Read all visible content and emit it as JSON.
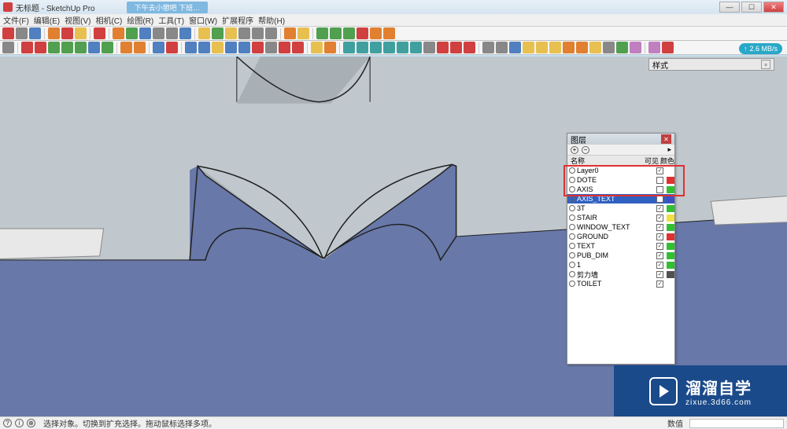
{
  "titlebar": {
    "title": "无标题 - SketchUp Pro",
    "tab": "下午去小憩吧  下班…"
  },
  "menubar": [
    "文件(F)",
    "编辑(E)",
    "视图(V)",
    "相机(C)",
    "绘图(R)",
    "工具(T)",
    "窗口(W)",
    "扩展程序",
    "帮助(H)"
  ],
  "speed": "2.6 MB/s",
  "style_panel": {
    "title": "样式"
  },
  "layers_panel": {
    "title": "图层",
    "header": {
      "name": "名称",
      "visible": "可见",
      "color": "颜色"
    },
    "rows": [
      {
        "name": "Layer0",
        "checked": true,
        "color": "#ffffff",
        "selected": false
      },
      {
        "name": "DOTE",
        "checked": false,
        "color": "#e03030",
        "selected": false
      },
      {
        "name": "AXIS",
        "checked": false,
        "color": "#30c030",
        "selected": false
      },
      {
        "name": "AXIS_TEXT",
        "checked": false,
        "color": "#4050c0",
        "selected": true
      },
      {
        "name": "3T",
        "checked": true,
        "color": "#30c030",
        "selected": false
      },
      {
        "name": "STAIR",
        "checked": true,
        "color": "#f0e040",
        "selected": false
      },
      {
        "name": "WINDOW_TEXT",
        "checked": true,
        "color": "#30c030",
        "selected": false
      },
      {
        "name": "GROUND",
        "checked": true,
        "color": "#e03030",
        "selected": false
      },
      {
        "name": "TEXT",
        "checked": true,
        "color": "#30c030",
        "selected": false
      },
      {
        "name": "PUB_DIM",
        "checked": true,
        "color": "#30c030",
        "selected": false
      },
      {
        "name": "1",
        "checked": true,
        "color": "#30c030",
        "selected": false
      },
      {
        "name": "剪力墙",
        "checked": true,
        "color": "#505050",
        "selected": false
      },
      {
        "name": "TOILET",
        "checked": true,
        "color": "#ffffff",
        "selected": false
      }
    ]
  },
  "statusbar": {
    "hint": "选择对象。切换到扩充选择。拖动鼠标选择多项。",
    "value_label": "数值"
  },
  "watermark": {
    "big": "溜溜自学",
    "small": "zixue.3d66.com"
  }
}
